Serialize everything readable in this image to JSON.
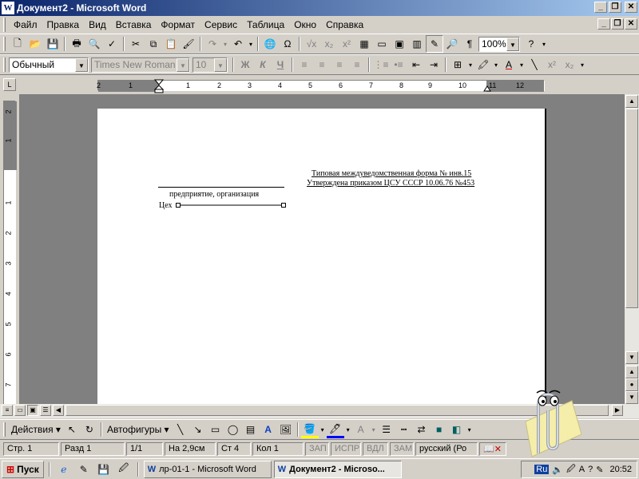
{
  "window": {
    "title": "Документ2 - Microsoft Word",
    "app_icon": "W"
  },
  "menu": [
    "Файл",
    "Правка",
    "Вид",
    "Вставка",
    "Формат",
    "Сервис",
    "Таблица",
    "Окно",
    "Справка"
  ],
  "standard_toolbar": {
    "zoom": "100%"
  },
  "formatting_toolbar": {
    "style": "Обычный",
    "font": "Times New Roman",
    "size": "10",
    "bold": "Ж",
    "italic": "К",
    "underline": "Ч"
  },
  "ruler": {
    "corner": "L",
    "numbers": [
      "2",
      "1",
      "1",
      "2",
      "3",
      "4",
      "5",
      "6",
      "7",
      "8",
      "9",
      "10",
      "11",
      "12"
    ],
    "v_numbers": [
      "2",
      "1",
      "1",
      "2",
      "3",
      "4",
      "5",
      "6",
      "7"
    ]
  },
  "document": {
    "form_title": "Типовая междуведомственная форма № инв.15",
    "approved": "Утверждена приказом ЦСУ СССР 10.06.76 №453",
    "org_caption": "предприятие, организация",
    "shop_label": "Цех"
  },
  "drawing_toolbar": {
    "actions": "Действия",
    "autoshapes": "Автофигуры"
  },
  "status": {
    "page": "Стр. 1",
    "section": "Разд 1",
    "pages": "1/1",
    "at": "На 2,9см",
    "line": "Ст 4",
    "col": "Кол 1",
    "rec": "ЗАП",
    "trk": "ИСПР",
    "ext": "ВДЛ",
    "ovr": "ЗАМ",
    "lang": "русский (Ро"
  },
  "taskbar": {
    "start": "Пуск",
    "tasks": [
      "лр-01-1 - Microsoft Word",
      "Документ2 - Microso..."
    ],
    "lang": "Ru",
    "clock": "20:52"
  }
}
